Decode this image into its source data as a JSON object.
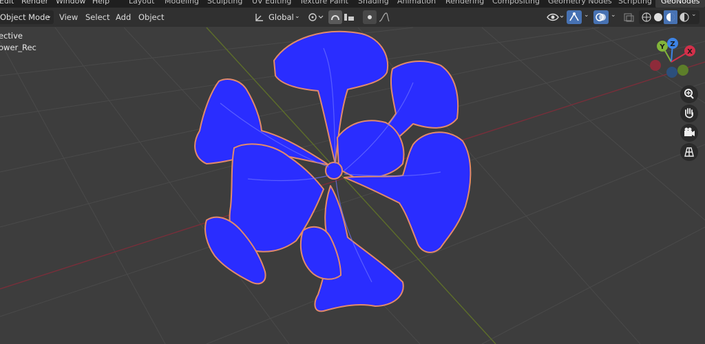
{
  "menu": {
    "items": [
      "Edit",
      "Render",
      "Window",
      "Help"
    ]
  },
  "workspaces": {
    "tabs": [
      "Layout",
      "Modeling",
      "Sculpting",
      "UV Editing",
      "Texture Paint",
      "Shading",
      "Animation",
      "Rendering",
      "Compositing",
      "Geometry Nodes",
      "Scripting"
    ],
    "active": "GeoNodes"
  },
  "header": {
    "mode": "Object Mode",
    "view": "View",
    "select": "Select",
    "add": "Add",
    "object": "Object",
    "orientation": "Global"
  },
  "viewport": {
    "perspective_label": "ective",
    "object_label": "ower_Rec"
  },
  "gizmo": {
    "x": "X",
    "y": "Y",
    "z": "Z"
  },
  "colors": {
    "flower": "#2a2dff",
    "outline": "#e38a6a",
    "x_axis": "#d3304a",
    "y_axis": "#82b53a",
    "z_axis": "#3d84e6",
    "grid_bg": "#3d3d3d",
    "header_bg": "#303030",
    "accent": "#4772b3"
  },
  "icons": [
    "transform-pivot-icon",
    "snap-icon",
    "proportional-icon",
    "visibility-icon",
    "gizmo-icon",
    "overlay-icon",
    "xray-icon",
    "shading-wireframe-icon",
    "shading-solid-icon",
    "shading-material-icon",
    "shading-rendered-icon",
    "zoom-icon",
    "hand-icon",
    "camera-icon",
    "grid-icon"
  ]
}
